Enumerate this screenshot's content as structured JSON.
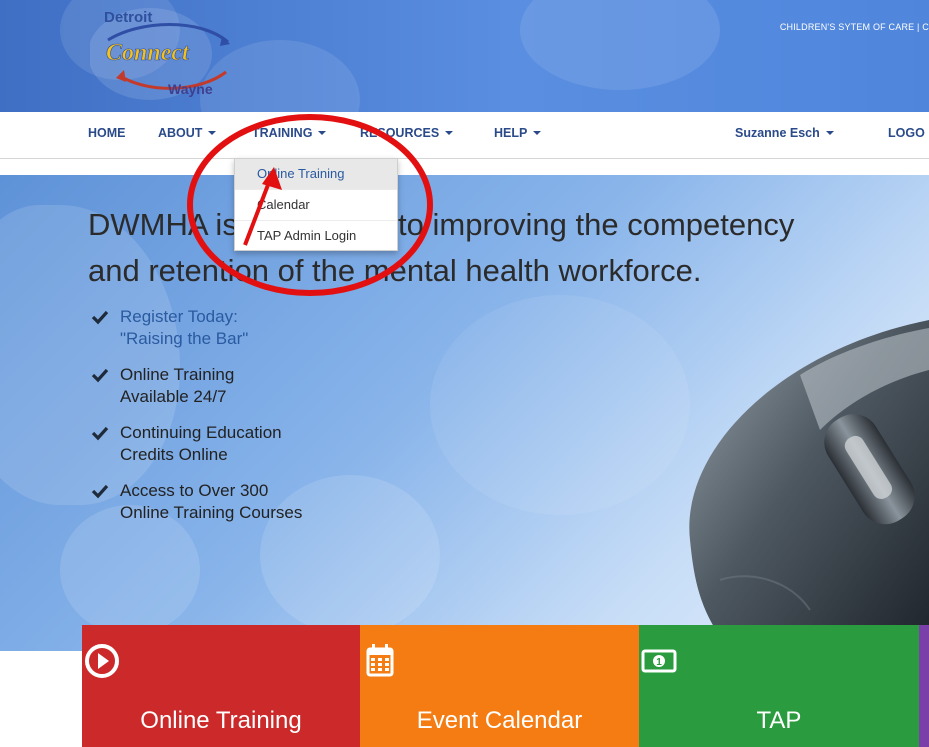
{
  "header": {
    "logo_text_top": "Detroit",
    "logo_text_main": "Connect",
    "logo_text_bottom": "Wayne",
    "top_links": "CHILDREN'S SYTEM OF CARE  |  C"
  },
  "nav": {
    "items": [
      {
        "label": "HOME"
      },
      {
        "label": "ABOUT"
      },
      {
        "label": "TRAINING"
      },
      {
        "label": "RESOURCES"
      },
      {
        "label": "HELP"
      }
    ],
    "user": "Suzanne Esch",
    "logout": "LOGO"
  },
  "dropdown": {
    "items": [
      "Online Training",
      "Calendar",
      "TAP Admin Login"
    ]
  },
  "hero": {
    "headline_line1": "DWMHA is committed to improving the competency",
    "headline_line2": "and retention of the mental health workforce.",
    "bullets": [
      {
        "line1": "Register Today:",
        "line2": "\"Raising the Bar\""
      },
      {
        "line1": "Online Training",
        "line2": "Available 24/7"
      },
      {
        "line1": "Continuing Education",
        "line2": "Credits Online"
      },
      {
        "line1": "Access to Over 300",
        "line2": "Online Training Courses"
      }
    ]
  },
  "tiles": [
    {
      "label": "Online Training",
      "icon": "play-circle-icon",
      "color": "#cc2a2a"
    },
    {
      "label": "Event Calendar",
      "icon": "calendar-icon",
      "color": "#f47c12"
    },
    {
      "label": "TAP",
      "icon": "money-bill-icon",
      "color": "#2a9b3e"
    },
    {
      "label": "",
      "icon": "",
      "color": "#7a3fa8"
    }
  ],
  "colors": {
    "nav_text": "#2a4a8a",
    "annotation": "#e21010"
  }
}
